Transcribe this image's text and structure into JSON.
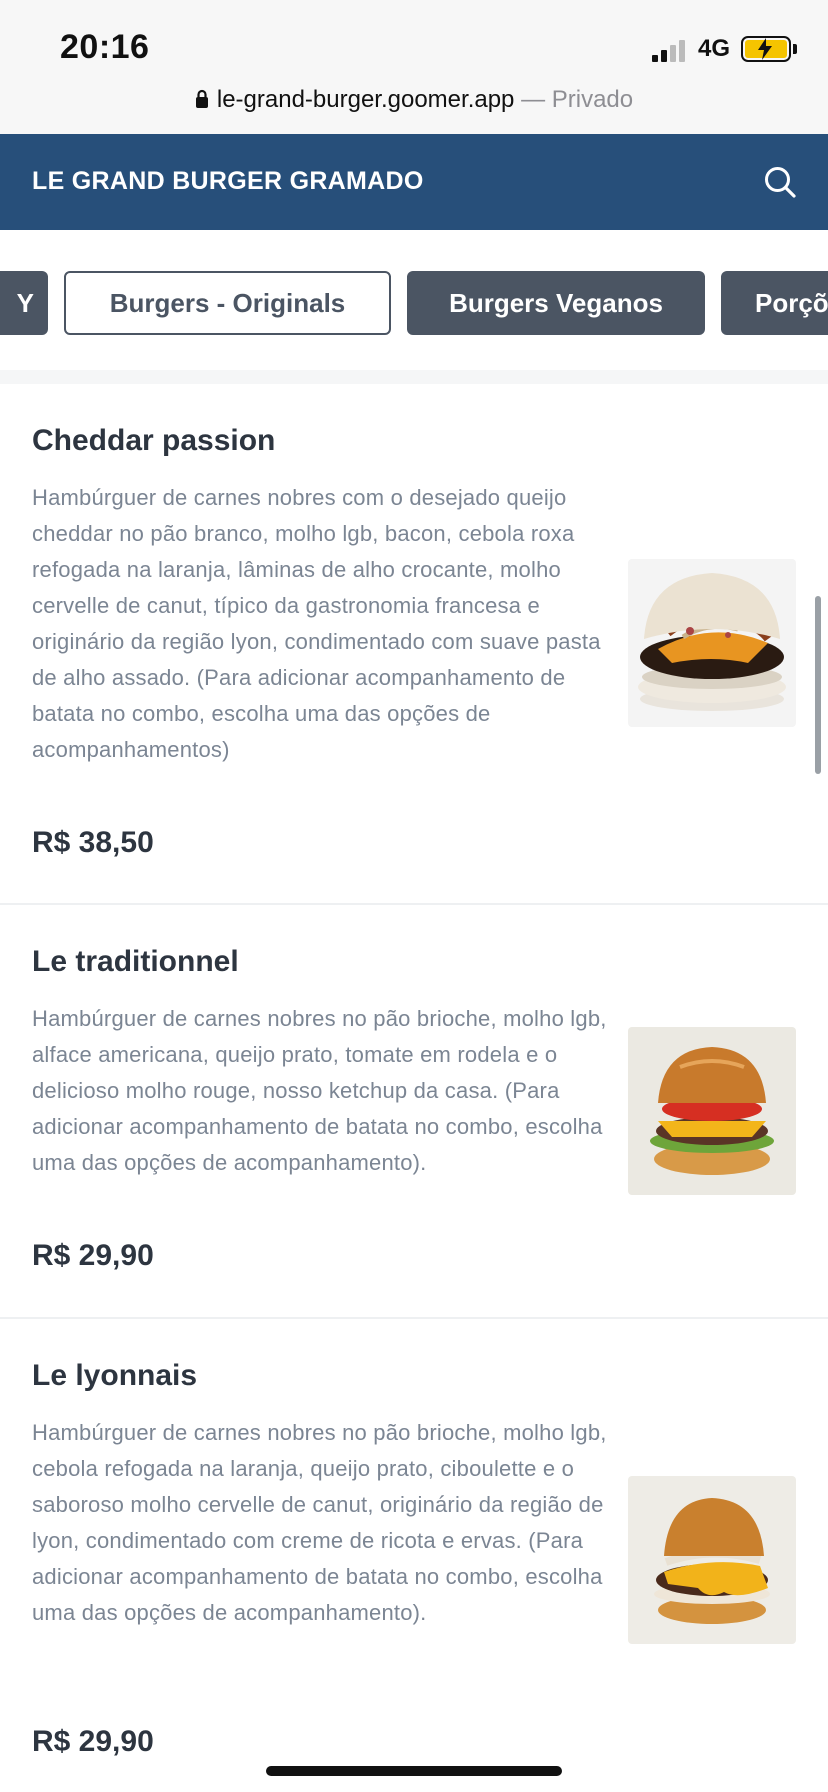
{
  "status": {
    "time": "20:16",
    "network": "4G"
  },
  "browser": {
    "url": "le-grand-burger.goomer.app",
    "separator": " — ",
    "privacy": "Privado"
  },
  "header": {
    "title": "LE GRAND BURGER GRAMADO"
  },
  "tabs": [
    {
      "label": "Y"
    },
    {
      "label": "Burgers - Originals"
    },
    {
      "label": "Burgers Veganos"
    },
    {
      "label": "Porções"
    }
  ],
  "items": [
    {
      "name": "Cheddar passion",
      "description": "Hambúrguer de carnes nobres com o desejado queijo cheddar no pão branco, molho lgb, bacon, cebola roxa refogada na laranja, lâminas de alho crocante, molho cervelle de canut, típico da gastronomia francesa e originário da região lyon, condimentado com suave pasta de alho assado. (Para adicionar acompanhamento de batata no combo, escolha uma das opções de acompanhamentos)",
      "price": "R$ 38,50"
    },
    {
      "name": "Le traditionnel",
      "description": "Hambúrguer de carnes nobres no pão brioche, molho lgb, alface americana, queijo prato, tomate em rodela e o delicioso molho rouge, nosso ketchup da casa. (Para adicionar acompanhamento de batata no combo, escolha uma das opções de acompanhamento).",
      "price": "R$ 29,90"
    },
    {
      "name": "Le lyonnais",
      "description": "Hambúrguer de carnes nobres no pão brioche, molho lgb, cebola refogada na laranja, queijo prato, ciboulette e o saboroso molho cervelle de canut, originário da região de lyon, condimentado com creme de ricota e ervas. (Para adicionar acompanhamento de batata no combo, escolha uma das opções de acompanhamento).",
      "price": "R$ 29,90"
    }
  ]
}
